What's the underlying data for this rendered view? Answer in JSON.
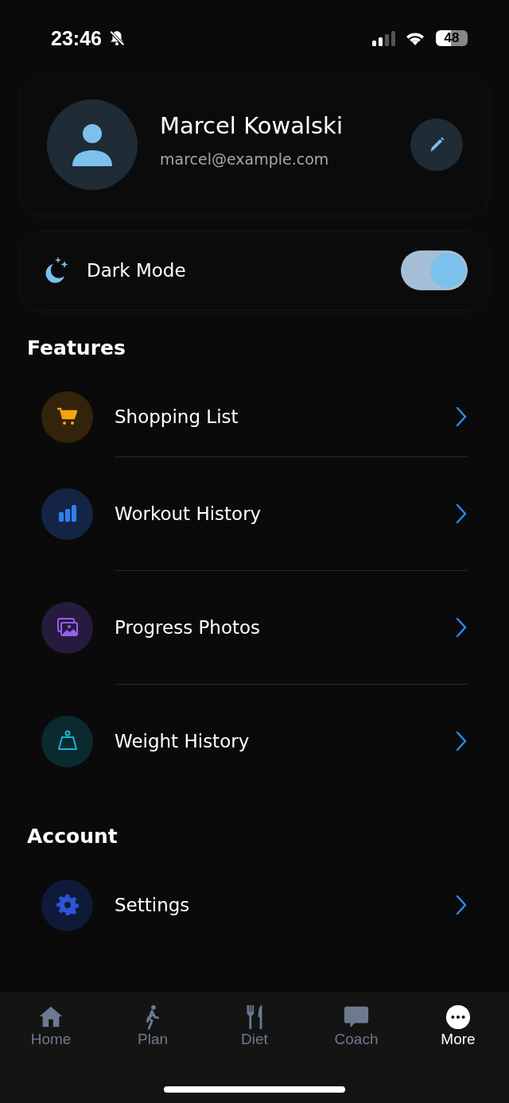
{
  "status_bar": {
    "time": "23:46",
    "silent": true,
    "battery": "48"
  },
  "profile": {
    "name": "Marcel Kowalski",
    "email": "marcel@example.com"
  },
  "dark_mode": {
    "label": "Dark Mode",
    "on": true
  },
  "sections": [
    {
      "title": "Features",
      "items": [
        {
          "kind": "cart",
          "label": "Shopping List"
        },
        {
          "kind": "chart",
          "label": "Workout History"
        },
        {
          "kind": "photos",
          "label": "Progress Photos"
        },
        {
          "kind": "weight",
          "label": "Weight History"
        }
      ]
    },
    {
      "title": "Account",
      "items": [
        {
          "kind": "gear",
          "label": "Settings"
        }
      ]
    }
  ],
  "tabs": [
    {
      "kind": "home",
      "label": "Home",
      "selected": false
    },
    {
      "kind": "walk",
      "label": "Plan",
      "selected": false
    },
    {
      "kind": "cutlery",
      "label": "Diet",
      "selected": false
    },
    {
      "kind": "chat",
      "label": "Coach",
      "selected": false
    },
    {
      "kind": "more",
      "label": "More",
      "selected": true
    }
  ]
}
